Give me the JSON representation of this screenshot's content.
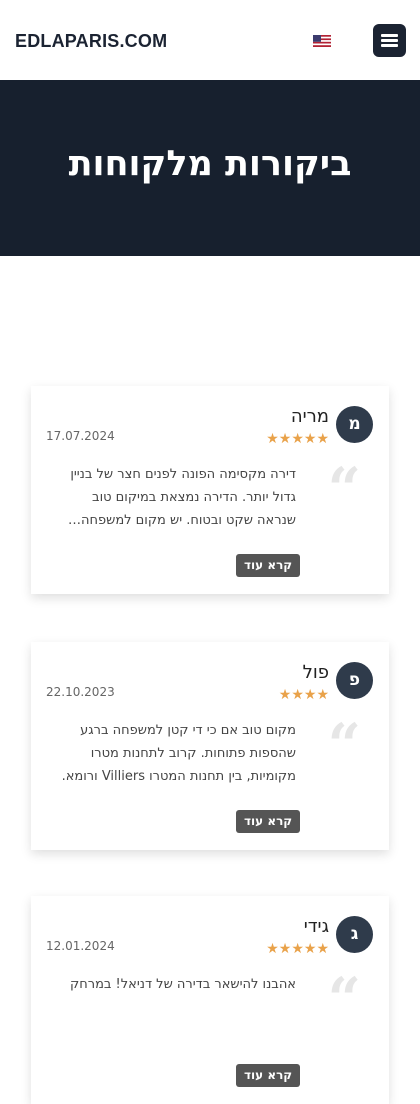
{
  "header": {
    "brand": "EDLAPARIS.COM",
    "language_flag": "us-flag-icon",
    "menu_icon": "hamburger-icon"
  },
  "hero": {
    "title": "ביקורות מלקוחות"
  },
  "colors": {
    "dark": "#17202e",
    "star": "#e9a24a",
    "button": "#555555"
  },
  "reviews": [
    {
      "initial": "מ",
      "name": "מריה",
      "rating": 5,
      "date": "17.07.2024",
      "text": "דירה מקסימה הפונה לפנים חצר של בניין גדול יותר. הדירה נמצאת במיקום טוב שנראה שקט ובטוח. יש מקום למשפחה…",
      "button": "קרא עוד"
    },
    {
      "initial": "פ",
      "name": "פול",
      "rating": 4,
      "date": "22.10.2023",
      "text": "מקום טוב אם כי די קטן למשפחה ברגע שהספות פתוחות. קרוב לתחנות מטרו מקומיות, בין תחנות המטרו Villiers ורומא.",
      "button": "קרא עוד"
    },
    {
      "initial": "ג",
      "name": "גידי",
      "rating": 5,
      "date": "12.01.2024",
      "text": "אהבנו להישאר בדירה של דניאל! במרחק",
      "button": "קרא עוד"
    }
  ]
}
